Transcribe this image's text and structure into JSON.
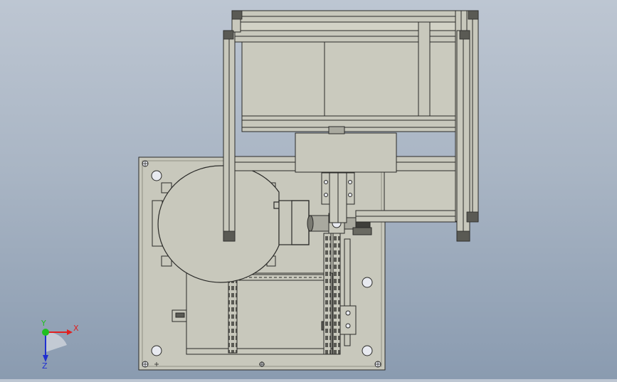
{
  "scene": {
    "background_top": "#bdc6d2",
    "background_bottom": "#8a9bb0",
    "part_fill": "#c8c8bc",
    "part_stroke": "#2a2a28"
  },
  "triad": {
    "x_label": "X",
    "y_label": "Y",
    "z_label": "Z",
    "x_color": "#e02020",
    "y_color": "#20c020",
    "z_color": "#2030d0"
  }
}
